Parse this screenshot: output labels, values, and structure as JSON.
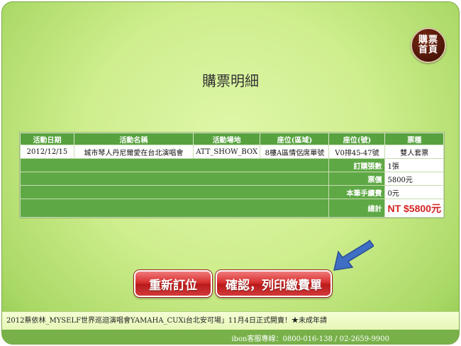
{
  "home_button": {
    "line1": "購票",
    "line2": "首頁"
  },
  "title": "購票明細",
  "table": {
    "headers": [
      "活動日期",
      "活動名稱",
      "活動場地",
      "座位(區域)",
      "座位(號)",
      "票種"
    ],
    "row": [
      "2012/12/15",
      "城市琴人丹尼爾愛在台北演唱會",
      "ATT_SHOW_BOX",
      "8樓A區情侶席單號",
      "V0排45-47號",
      "雙人套票"
    ]
  },
  "summary": {
    "qty_label": "訂購張數",
    "qty_value": "1張",
    "price_label": "票價",
    "price_value": "5800元",
    "fee_label": "本筆手續費",
    "fee_value": "0元",
    "total_label": "總計",
    "total_value": "NT $5800元"
  },
  "buttons": {
    "reorder": "重新訂位",
    "confirm": "確認，列印繳費單"
  },
  "marquee": "2012蔡依林_MYSELF世界巡迴演唱會YAMAHA_CUXi台北安可場」11月4日正式開賣！★未成年請",
  "footer": "ibon客服專線：0800-016-138 / 02-2659-9900",
  "colors": {
    "header_green": "#57a23f",
    "button_red": "#d83030",
    "arrow_blue": "#3f6fc4",
    "total_red": "#d42222"
  }
}
